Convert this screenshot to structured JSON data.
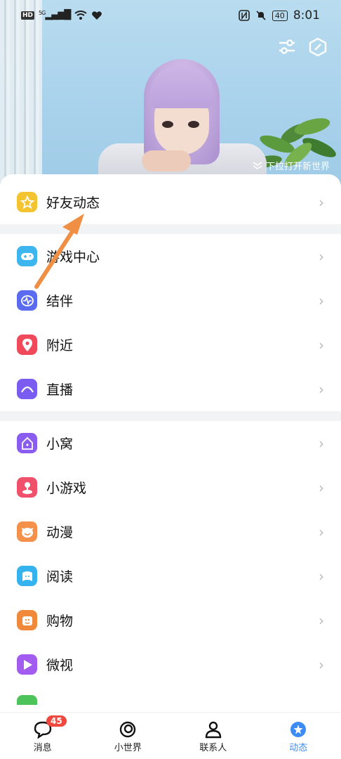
{
  "status_bar": {
    "left_badge": "HD",
    "signal": "5G",
    "battery": "40",
    "time": "8:01"
  },
  "header": {
    "pull_hint": "下拉打开新世界",
    "icons": [
      "sliders-icon",
      "hexagon-icon"
    ]
  },
  "menu": {
    "group1": [
      {
        "label": "好友动态",
        "icon": "star-icon",
        "color": "#f4c430"
      }
    ],
    "group2": [
      {
        "label": "游戏中心",
        "icon": "gamepad-icon",
        "color": "#3db5ee"
      },
      {
        "label": "结伴",
        "icon": "pulse-icon",
        "color": "#5b6bf0"
      },
      {
        "label": "附近",
        "icon": "location-pin-icon",
        "color": "#f04a5a"
      },
      {
        "label": "直播",
        "icon": "live-icon",
        "color": "#7a5cf0"
      }
    ],
    "group3": [
      {
        "label": "小窝",
        "icon": "home-icon",
        "color": "#8a5cf0"
      },
      {
        "label": "小游戏",
        "icon": "joystick-icon",
        "color": "#f0506a"
      },
      {
        "label": "动漫",
        "icon": "comic-face-icon",
        "color": "#f5904a"
      },
      {
        "label": "阅读",
        "icon": "book-icon",
        "color": "#35b3ef"
      },
      {
        "label": "购物",
        "icon": "shopping-icon",
        "color": "#f08a3a"
      },
      {
        "label": "微视",
        "icon": "play-icon",
        "color": "#a35cf0"
      }
    ]
  },
  "bottom_nav": [
    {
      "label": "消息",
      "badge": "45"
    },
    {
      "label": "小世界"
    },
    {
      "label": "联系人"
    },
    {
      "label": "动态"
    }
  ],
  "colors": {
    "accent": "#3d8bf5",
    "badge": "#f0483e"
  }
}
